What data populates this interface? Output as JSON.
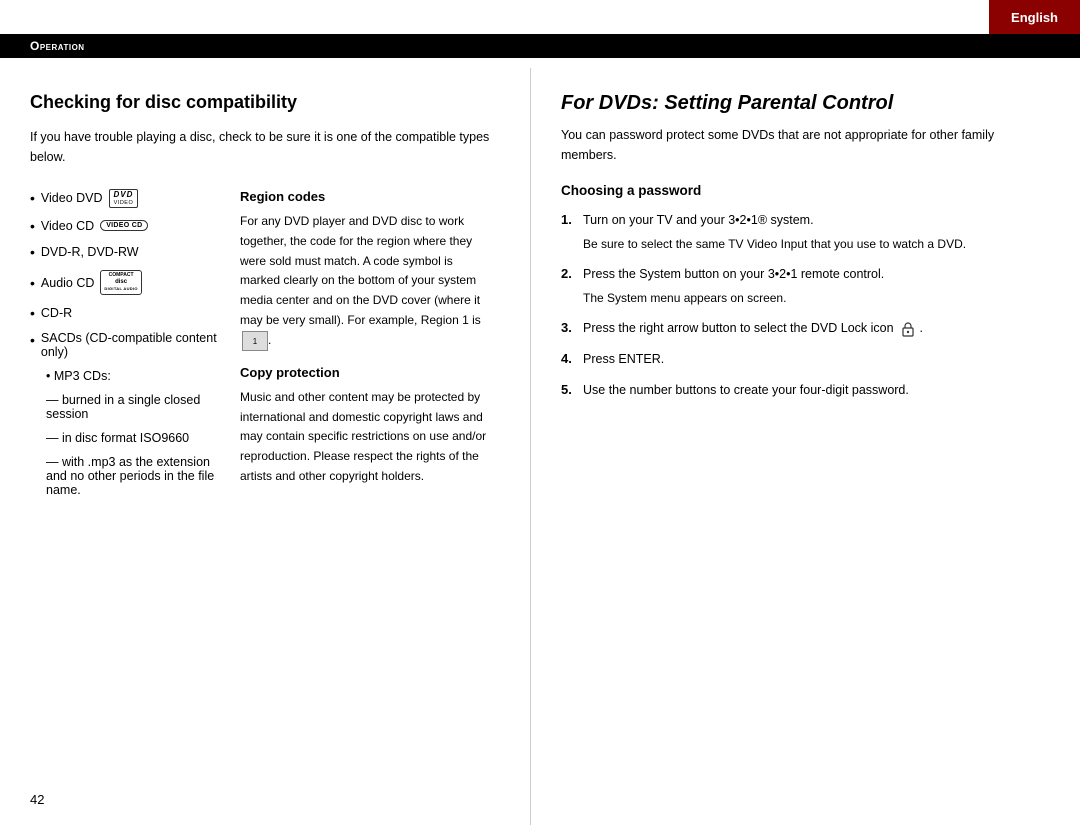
{
  "lang_tab": "English",
  "section_header": "Operation",
  "left": {
    "title": "Checking for disc compatibility",
    "intro": "If you have trouble playing a disc, check to be sure it is one of the compatible types below.",
    "disc_items": [
      {
        "label": "Video DVD",
        "has_logo": "dvd"
      },
      {
        "label": "Video CD",
        "has_logo": "videocd"
      },
      {
        "label": "DVD-R, DVD-RW",
        "has_logo": "none"
      },
      {
        "label": "Audio CD",
        "has_logo": "compact"
      },
      {
        "label": "CD-R",
        "has_logo": "none"
      },
      {
        "label": "SACDs (CD-compatible content only)",
        "has_logo": "none"
      },
      {
        "label": "MP3 CDs:",
        "has_logo": "none"
      }
    ],
    "mp3_sub_items": [
      "burned in a single closed session",
      "in disc format ISO9660",
      "with .mp3 as the extension and no other periods in the file name."
    ],
    "region_title": "Region codes",
    "region_text": "For any DVD player and DVD disc to work together, the code for the region where they were sold must match. A code symbol is marked clearly on the bottom of your system media center and on the DVD cover (where it may be very small). For example, Region 1 is",
    "copy_title": "Copy protection",
    "copy_text": "Music and other content may be protected by international and domestic copyright laws and may contain specific restrictions on use and/or reproduction. Please respect the rights of the artists and other copyright holders."
  },
  "right": {
    "title": "For DVDs: Setting Parental Control",
    "intro": "You can password protect some DVDs that are not appropriate for other family members.",
    "choosing_title": "Choosing a password",
    "steps": [
      {
        "number": "1",
        "text": "Turn on your TV and your 3•2•1® system.",
        "sub": "Be sure to select the same TV Video Input that you use to watch a DVD."
      },
      {
        "number": "2",
        "text": "Press the System button on your 3•2•1 remote control.",
        "sub": "The System menu appears on screen."
      },
      {
        "number": "3",
        "text": "Press the right arrow button to select the DVD Lock icon",
        "sub": ""
      },
      {
        "number": "4",
        "text": "Press ENTER.",
        "sub": ""
      },
      {
        "number": "5",
        "text": "Use the number buttons to create your four-digit password.",
        "sub": ""
      }
    ]
  },
  "page_number": "42"
}
